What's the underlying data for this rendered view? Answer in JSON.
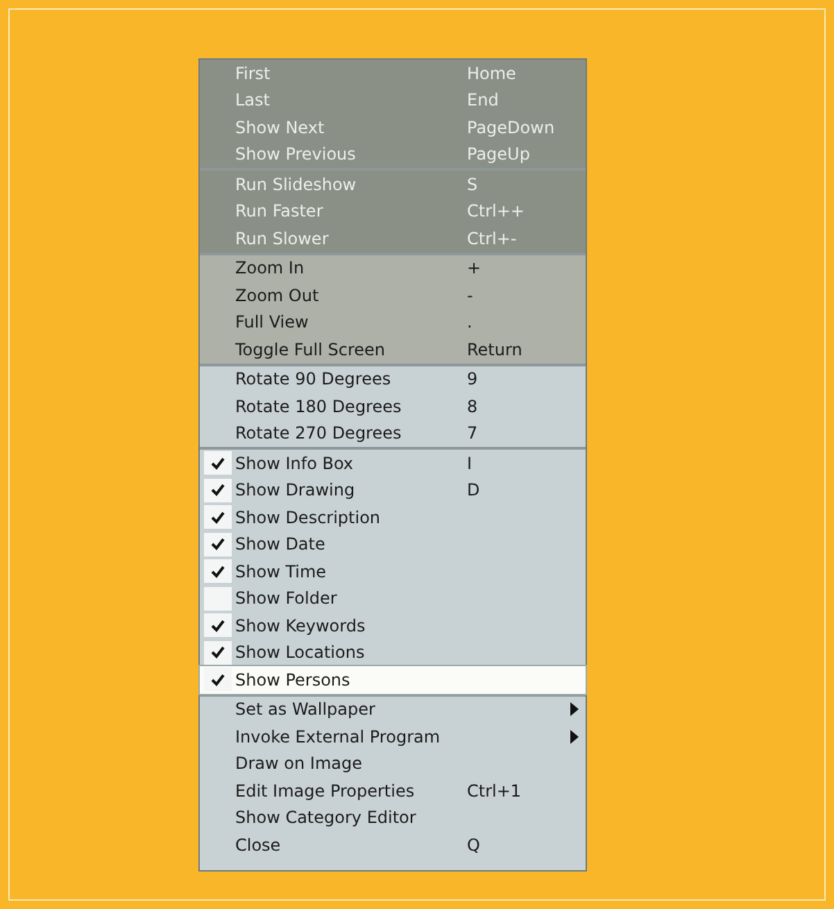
{
  "menu": {
    "sections": [
      {
        "kind": "dark",
        "items": [
          {
            "label": "First",
            "shortcut": "Home",
            "selected": false
          },
          {
            "label": "Last",
            "shortcut": "End",
            "selected": false
          },
          {
            "label": "Show Next",
            "shortcut": "PageDown",
            "selected": false
          },
          {
            "label": "Show Previous",
            "shortcut": "PageUp",
            "selected": false
          }
        ]
      },
      {
        "kind": "dark",
        "items": [
          {
            "label": "Run Slideshow",
            "shortcut": "S",
            "selected": false
          },
          {
            "label": "Run Faster",
            "shortcut": "Ctrl++",
            "selected": false
          },
          {
            "label": "Run Slower",
            "shortcut": "Ctrl+-",
            "selected": false
          }
        ]
      },
      {
        "kind": "mid",
        "items": [
          {
            "label": "Zoom In",
            "shortcut": "+",
            "selected": false
          },
          {
            "label": "Zoom Out",
            "shortcut": "-",
            "selected": false
          },
          {
            "label": "Full View",
            "shortcut": ".",
            "selected": false
          },
          {
            "label": "Toggle Full Screen",
            "shortcut": "Return",
            "selected": false
          }
        ]
      },
      {
        "kind": "light",
        "items": [
          {
            "label": "Rotate 90 Degrees",
            "shortcut": "9",
            "selected": false
          },
          {
            "label": "Rotate 180 Degrees",
            "shortcut": "8",
            "selected": false
          },
          {
            "label": "Rotate 270 Degrees",
            "shortcut": "7",
            "selected": false
          }
        ]
      },
      {
        "kind": "light",
        "items": [
          {
            "kind": "check",
            "label": "Show Info Box",
            "shortcut": "I",
            "checked": true,
            "selected": false
          },
          {
            "kind": "check",
            "label": "Show Drawing",
            "shortcut": "D",
            "checked": true,
            "selected": false
          },
          {
            "kind": "check",
            "label": "Show Description",
            "checked": true,
            "selected": false
          },
          {
            "kind": "check",
            "label": "Show Date",
            "checked": true,
            "selected": false
          },
          {
            "kind": "check",
            "label": "Show Time",
            "checked": true,
            "selected": false
          },
          {
            "kind": "check",
            "label": "Show Folder",
            "checked": false,
            "selected": false
          },
          {
            "kind": "check",
            "label": "Show Keywords",
            "checked": true,
            "selected": false
          },
          {
            "kind": "check",
            "label": "Show Locations",
            "checked": true,
            "selected": false
          },
          {
            "kind": "check",
            "label": "Show Persons",
            "checked": true,
            "selected": true
          }
        ]
      },
      {
        "kind": "light",
        "items": [
          {
            "label": "Set as Wallpaper",
            "submenu": true,
            "selected": false
          },
          {
            "label": "Invoke External Program",
            "submenu": true,
            "selected": false
          },
          {
            "label": "Draw on Image",
            "selected": false
          },
          {
            "label": "Edit Image Properties",
            "shortcut": "Ctrl+1",
            "selected": false
          },
          {
            "label": "Show Category Editor",
            "selected": false
          },
          {
            "label": "Close",
            "shortcut": "Q",
            "selected": false
          }
        ]
      }
    ]
  }
}
